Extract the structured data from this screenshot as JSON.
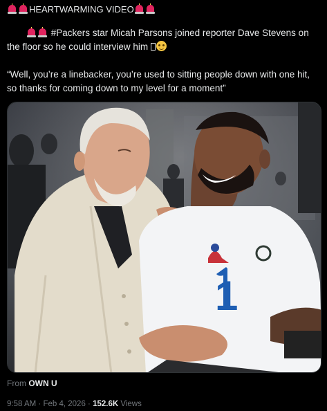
{
  "post": {
    "headline": "HEARTWARMING VIDEO",
    "body_text": "#Packers star Micah Parsons joined reporter Dave Stevens on the floor so he could interview him",
    "quote_text": "“Well, you’re a linebacker, you’re used to sitting people down with one hit, so thanks for coming down to my level for a moment”",
    "source_prefix": "From",
    "source_name": "OWN U",
    "time": "9:58 AM",
    "separator": "·",
    "date": "Feb 4, 2026",
    "views_count": "152.6K",
    "views_label": "Views"
  },
  "icons": {
    "headline_emoji": "police-car-light",
    "reaction_emoji": "smiling-face-with-tear"
  },
  "colors": {
    "background": "#000000",
    "text": "#e7e9ea",
    "muted": "#71767b",
    "siren_red": "#e0245e"
  }
}
